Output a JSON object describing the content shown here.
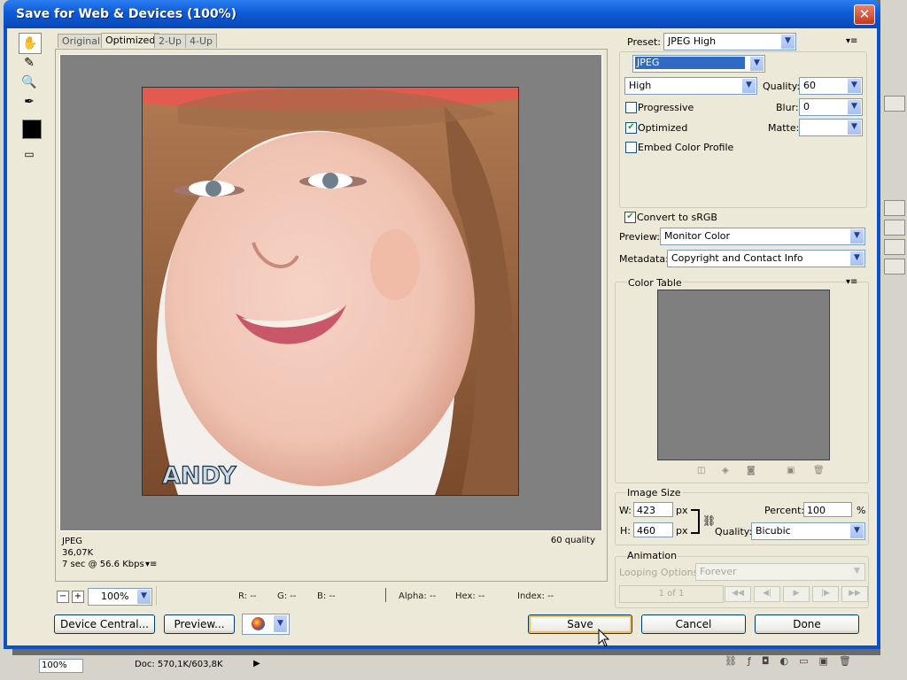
{
  "window": {
    "title": "Save for Web & Devices (100%)"
  },
  "tabs": [
    "Original",
    "Optimized",
    "2-Up",
    "4-Up"
  ],
  "preview": {
    "watermark_text": "ANDY",
    "info_left": [
      "JPEG",
      "36,07K",
      "7 sec @ 56.6 Kbps"
    ],
    "info_right": "60 quality"
  },
  "readout": {
    "zoom": "100%",
    "r": "R: --",
    "g": "G: --",
    "b": "B: --",
    "alpha": "Alpha: --",
    "hex": "Hex: --",
    "index": "Index: --"
  },
  "buttons": {
    "device_central": "Device Central...",
    "preview": "Preview...",
    "save": "Save",
    "cancel": "Cancel",
    "done": "Done"
  },
  "settings": {
    "preset_label": "Preset:",
    "preset_value": "JPEG High",
    "format_value": "JPEG",
    "quality_level": "High",
    "quality_label": "Quality:",
    "quality_value": "60",
    "progressive": "Progressive",
    "blur_label": "Blur:",
    "blur_value": "0",
    "optimized": "Optimized",
    "matte_label": "Matte:",
    "matte_value": "",
    "embed_profile": "Embed Color Profile",
    "convert_srgb": "Convert to sRGB",
    "preview_label": "Preview:",
    "preview_value": "Monitor Color",
    "metadata_label": "Metadata:",
    "metadata_value": "Copyright and Contact Info",
    "checks": {
      "progressive": false,
      "optimized": true,
      "embed_profile": false,
      "convert_srgb": true
    }
  },
  "color_table": {
    "title": "Color Table"
  },
  "image_size": {
    "title": "Image Size",
    "w_label": "W:",
    "w_value": "423",
    "w_unit": "px",
    "h_label": "H:",
    "h_value": "460",
    "h_unit": "px",
    "percent_label": "Percent:",
    "percent_value": "100",
    "percent_unit": "%",
    "quality_label": "Quality:",
    "quality_value": "Bicubic"
  },
  "animation": {
    "title": "Animation",
    "looping_label": "Looping Options:",
    "looping_value": "Forever",
    "frame_counter": "1 of 1"
  },
  "status": {
    "zoom": "100%",
    "doc": "Doc: 570,1K/603,8K"
  },
  "colors": {
    "title_blue": "#0a52c8",
    "dialog_bg": "#ece9d8",
    "preview_gray": "#808080",
    "swatch": "#000000"
  }
}
